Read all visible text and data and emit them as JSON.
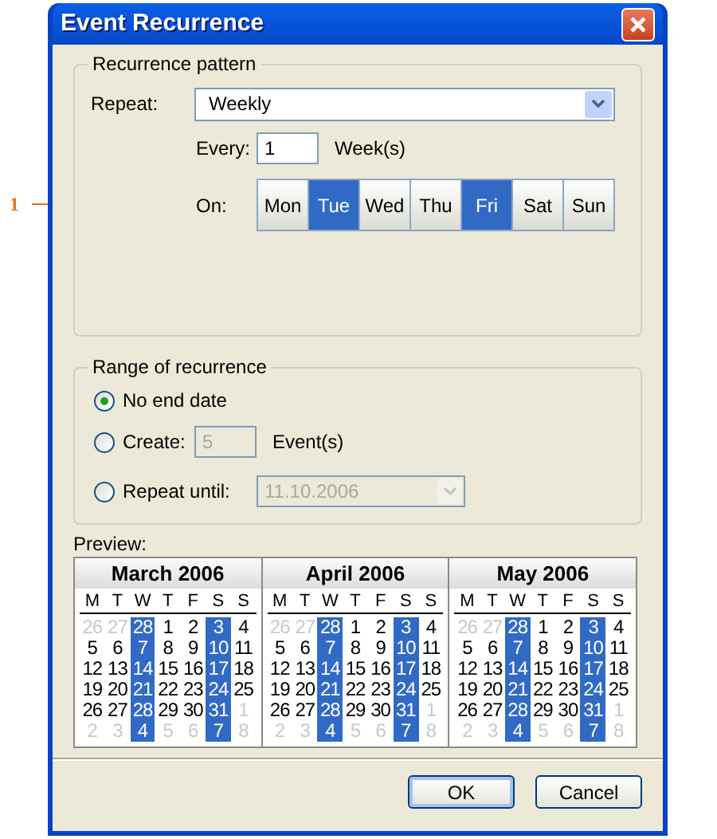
{
  "annotation": {
    "label": "1"
  },
  "window": {
    "title": "Event Recurrence"
  },
  "recurrence_pattern": {
    "title": "Recurrence pattern",
    "repeat_label": "Repeat:",
    "repeat_value": "Weekly",
    "every_label": "Every:",
    "every_value": "1",
    "every_unit": "Week(s)",
    "on_label": "On:",
    "days": [
      {
        "label": "Mon",
        "selected": false
      },
      {
        "label": "Tue",
        "selected": true
      },
      {
        "label": "Wed",
        "selected": false
      },
      {
        "label": "Thu",
        "selected": false
      },
      {
        "label": "Fri",
        "selected": true
      },
      {
        "label": "Sat",
        "selected": false
      },
      {
        "label": "Sun",
        "selected": false
      }
    ]
  },
  "range_of_recurrence": {
    "title": "Range of recurrence",
    "options": [
      {
        "kind": "plain",
        "label": "No end date",
        "selected": true
      },
      {
        "kind": "count",
        "label": "Create:",
        "value": "5",
        "unit": "Event(s)",
        "disabled": true,
        "selected": false
      },
      {
        "kind": "date",
        "label": "Repeat until:",
        "value": "11.10.2006",
        "disabled": true,
        "selected": false
      }
    ]
  },
  "preview": {
    "label": "Preview:",
    "months": [
      {
        "title": "March 2006",
        "weekdays": [
          "M",
          "T",
          "W",
          "T",
          "F",
          "S",
          "S"
        ],
        "weeks": [
          [
            {
              "d": "26",
              "muted": true,
              "selected": false
            },
            {
              "d": "27",
              "muted": true,
              "selected": false
            },
            {
              "d": "28",
              "muted": false,
              "selected": true
            },
            {
              "d": "1",
              "muted": false,
              "selected": false
            },
            {
              "d": "2",
              "muted": false,
              "selected": false
            },
            {
              "d": "3",
              "muted": false,
              "selected": true
            },
            {
              "d": "4",
              "muted": false,
              "selected": false
            }
          ],
          [
            {
              "d": "5",
              "muted": false,
              "selected": false
            },
            {
              "d": "6",
              "muted": false,
              "selected": false
            },
            {
              "d": "7",
              "muted": false,
              "selected": true
            },
            {
              "d": "8",
              "muted": false,
              "selected": false
            },
            {
              "d": "9",
              "muted": false,
              "selected": false
            },
            {
              "d": "10",
              "muted": false,
              "selected": true
            },
            {
              "d": "11",
              "muted": false,
              "selected": false
            }
          ],
          [
            {
              "d": "12",
              "muted": false,
              "selected": false
            },
            {
              "d": "13",
              "muted": false,
              "selected": false
            },
            {
              "d": "14",
              "muted": false,
              "selected": true
            },
            {
              "d": "15",
              "muted": false,
              "selected": false
            },
            {
              "d": "16",
              "muted": false,
              "selected": false
            },
            {
              "d": "17",
              "muted": false,
              "selected": true
            },
            {
              "d": "18",
              "muted": false,
              "selected": false
            }
          ],
          [
            {
              "d": "19",
              "muted": false,
              "selected": false
            },
            {
              "d": "20",
              "muted": false,
              "selected": false
            },
            {
              "d": "21",
              "muted": false,
              "selected": true
            },
            {
              "d": "22",
              "muted": false,
              "selected": false
            },
            {
              "d": "23",
              "muted": false,
              "selected": false
            },
            {
              "d": "24",
              "muted": false,
              "selected": true
            },
            {
              "d": "25",
              "muted": false,
              "selected": false
            }
          ],
          [
            {
              "d": "26",
              "muted": false,
              "selected": false
            },
            {
              "d": "27",
              "muted": false,
              "selected": false
            },
            {
              "d": "28",
              "muted": false,
              "selected": true
            },
            {
              "d": "29",
              "muted": false,
              "selected": false
            },
            {
              "d": "30",
              "muted": false,
              "selected": false
            },
            {
              "d": "31",
              "muted": false,
              "selected": true
            },
            {
              "d": "1",
              "muted": true,
              "selected": false
            }
          ],
          [
            {
              "d": "2",
              "muted": true,
              "selected": false
            },
            {
              "d": "3",
              "muted": true,
              "selected": false
            },
            {
              "d": "4",
              "muted": false,
              "selected": true
            },
            {
              "d": "5",
              "muted": true,
              "selected": false
            },
            {
              "d": "6",
              "muted": true,
              "selected": false
            },
            {
              "d": "7",
              "muted": false,
              "selected": true
            },
            {
              "d": "8",
              "muted": true,
              "selected": false
            }
          ]
        ]
      },
      {
        "title": "April 2006",
        "weekdays": [
          "M",
          "T",
          "W",
          "T",
          "F",
          "S",
          "S"
        ],
        "weeks": [
          [
            {
              "d": "26",
              "muted": true,
              "selected": false
            },
            {
              "d": "27",
              "muted": true,
              "selected": false
            },
            {
              "d": "28",
              "muted": false,
              "selected": true
            },
            {
              "d": "1",
              "muted": false,
              "selected": false
            },
            {
              "d": "2",
              "muted": false,
              "selected": false
            },
            {
              "d": "3",
              "muted": false,
              "selected": true
            },
            {
              "d": "4",
              "muted": false,
              "selected": false
            }
          ],
          [
            {
              "d": "5",
              "muted": false,
              "selected": false
            },
            {
              "d": "6",
              "muted": false,
              "selected": false
            },
            {
              "d": "7",
              "muted": false,
              "selected": true
            },
            {
              "d": "8",
              "muted": false,
              "selected": false
            },
            {
              "d": "9",
              "muted": false,
              "selected": false
            },
            {
              "d": "10",
              "muted": false,
              "selected": true
            },
            {
              "d": "11",
              "muted": false,
              "selected": false
            }
          ],
          [
            {
              "d": "12",
              "muted": false,
              "selected": false
            },
            {
              "d": "13",
              "muted": false,
              "selected": false
            },
            {
              "d": "14",
              "muted": false,
              "selected": true
            },
            {
              "d": "15",
              "muted": false,
              "selected": false
            },
            {
              "d": "16",
              "muted": false,
              "selected": false
            },
            {
              "d": "17",
              "muted": false,
              "selected": true
            },
            {
              "d": "18",
              "muted": false,
              "selected": false
            }
          ],
          [
            {
              "d": "19",
              "muted": false,
              "selected": false
            },
            {
              "d": "20",
              "muted": false,
              "selected": false
            },
            {
              "d": "21",
              "muted": false,
              "selected": true
            },
            {
              "d": "22",
              "muted": false,
              "selected": false
            },
            {
              "d": "23",
              "muted": false,
              "selected": false
            },
            {
              "d": "24",
              "muted": false,
              "selected": true
            },
            {
              "d": "25",
              "muted": false,
              "selected": false
            }
          ],
          [
            {
              "d": "26",
              "muted": false,
              "selected": false
            },
            {
              "d": "27",
              "muted": false,
              "selected": false
            },
            {
              "d": "28",
              "muted": false,
              "selected": true
            },
            {
              "d": "29",
              "muted": false,
              "selected": false
            },
            {
              "d": "30",
              "muted": false,
              "selected": false
            },
            {
              "d": "31",
              "muted": false,
              "selected": true
            },
            {
              "d": "1",
              "muted": true,
              "selected": false
            }
          ],
          [
            {
              "d": "2",
              "muted": true,
              "selected": false
            },
            {
              "d": "3",
              "muted": true,
              "selected": false
            },
            {
              "d": "4",
              "muted": false,
              "selected": true
            },
            {
              "d": "5",
              "muted": true,
              "selected": false
            },
            {
              "d": "6",
              "muted": true,
              "selected": false
            },
            {
              "d": "7",
              "muted": false,
              "selected": true
            },
            {
              "d": "8",
              "muted": true,
              "selected": false
            }
          ]
        ]
      },
      {
        "title": "May 2006",
        "weekdays": [
          "M",
          "T",
          "W",
          "T",
          "F",
          "S",
          "S"
        ],
        "weeks": [
          [
            {
              "d": "26",
              "muted": true,
              "selected": false
            },
            {
              "d": "27",
              "muted": true,
              "selected": false
            },
            {
              "d": "28",
              "muted": false,
              "selected": true
            },
            {
              "d": "1",
              "muted": false,
              "selected": false
            },
            {
              "d": "2",
              "muted": false,
              "selected": false
            },
            {
              "d": "3",
              "muted": false,
              "selected": true
            },
            {
              "d": "4",
              "muted": false,
              "selected": false
            }
          ],
          [
            {
              "d": "5",
              "muted": false,
              "selected": false
            },
            {
              "d": "6",
              "muted": false,
              "selected": false
            },
            {
              "d": "7",
              "muted": false,
              "selected": true
            },
            {
              "d": "8",
              "muted": false,
              "selected": false
            },
            {
              "d": "9",
              "muted": false,
              "selected": false
            },
            {
              "d": "10",
              "muted": false,
              "selected": true
            },
            {
              "d": "11",
              "muted": false,
              "selected": false
            }
          ],
          [
            {
              "d": "12",
              "muted": false,
              "selected": false
            },
            {
              "d": "13",
              "muted": false,
              "selected": false
            },
            {
              "d": "14",
              "muted": false,
              "selected": true
            },
            {
              "d": "15",
              "muted": false,
              "selected": false
            },
            {
              "d": "16",
              "muted": false,
              "selected": false
            },
            {
              "d": "17",
              "muted": false,
              "selected": true
            },
            {
              "d": "18",
              "muted": false,
              "selected": false
            }
          ],
          [
            {
              "d": "19",
              "muted": false,
              "selected": false
            },
            {
              "d": "20",
              "muted": false,
              "selected": false
            },
            {
              "d": "21",
              "muted": false,
              "selected": true
            },
            {
              "d": "22",
              "muted": false,
              "selected": false
            },
            {
              "d": "23",
              "muted": false,
              "selected": false
            },
            {
              "d": "24",
              "muted": false,
              "selected": true
            },
            {
              "d": "25",
              "muted": false,
              "selected": false
            }
          ],
          [
            {
              "d": "26",
              "muted": false,
              "selected": false
            },
            {
              "d": "27",
              "muted": false,
              "selected": false
            },
            {
              "d": "28",
              "muted": false,
              "selected": true
            },
            {
              "d": "29",
              "muted": false,
              "selected": false
            },
            {
              "d": "30",
              "muted": false,
              "selected": false
            },
            {
              "d": "31",
              "muted": false,
              "selected": true
            },
            {
              "d": "1",
              "muted": true,
              "selected": false
            }
          ],
          [
            {
              "d": "2",
              "muted": true,
              "selected": false
            },
            {
              "d": "3",
              "muted": true,
              "selected": false
            },
            {
              "d": "4",
              "muted": false,
              "selected": true
            },
            {
              "d": "5",
              "muted": true,
              "selected": false
            },
            {
              "d": "6",
              "muted": true,
              "selected": false
            },
            {
              "d": "7",
              "muted": false,
              "selected": true
            },
            {
              "d": "8",
              "muted": true,
              "selected": false
            }
          ]
        ]
      }
    ]
  },
  "buttons": [
    {
      "label": "OK",
      "default": true
    },
    {
      "label": "Cancel",
      "default": false
    }
  ]
}
